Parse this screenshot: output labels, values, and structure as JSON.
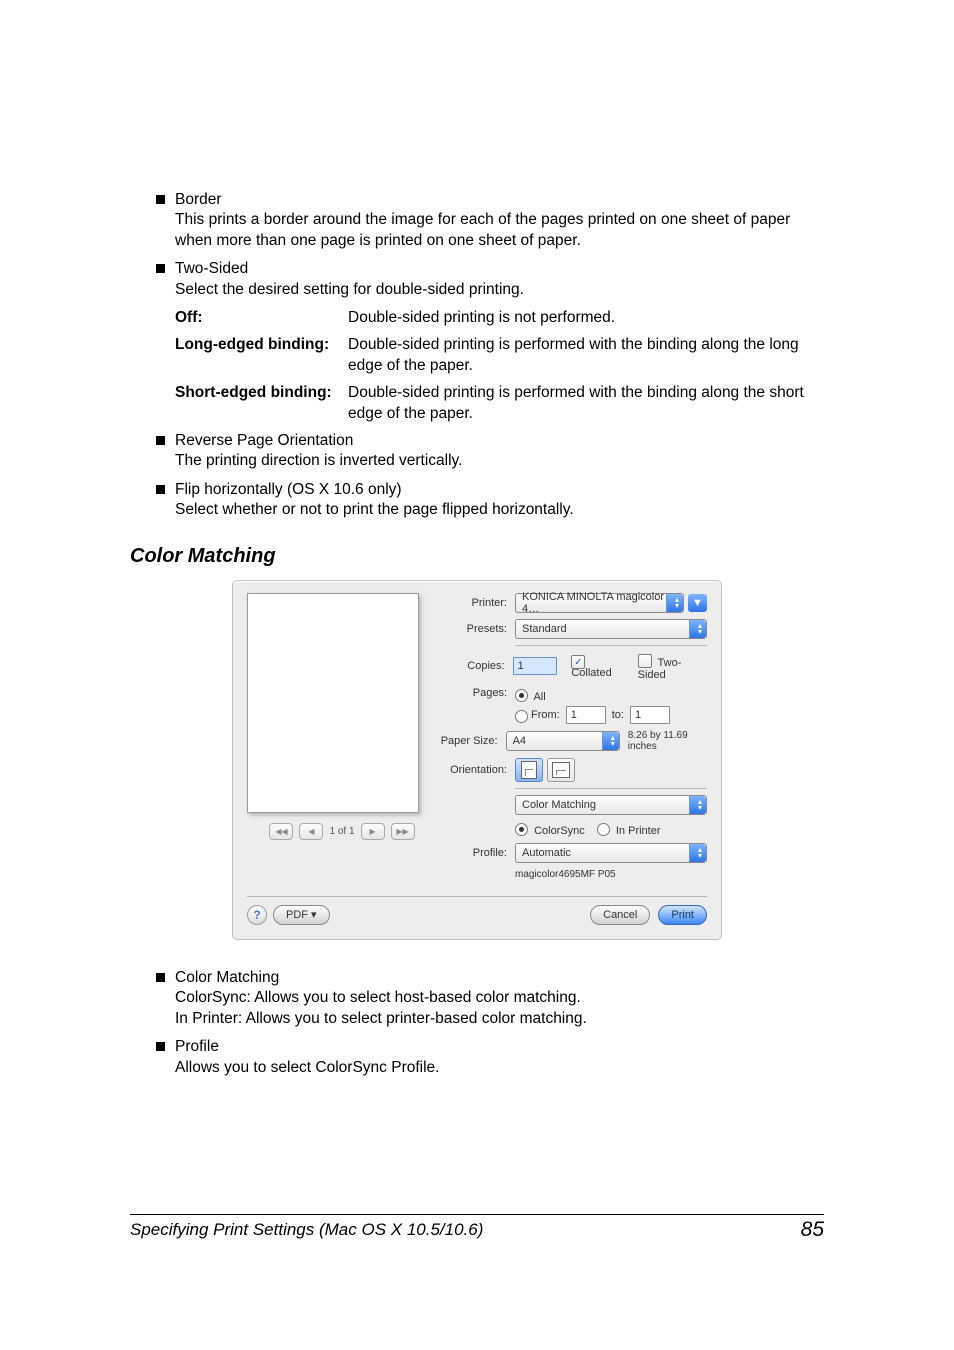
{
  "bullets": {
    "border": {
      "title": "Border",
      "body": "This prints a border around the image for each of the pages printed on one sheet of paper when more than one page is printed on one sheet of paper."
    },
    "twosided": {
      "title": "Two-Sided",
      "body": "Select the desired setting for double-sided printing."
    },
    "reverse": {
      "title": "Reverse Page Orientation",
      "body": "The printing direction is inverted vertically."
    },
    "flip": {
      "title": "Flip horizontally (OS X 10.6 only)",
      "body": "Select whether or not to print the page flipped horizontally."
    },
    "colormatching": {
      "title": "Color Matching",
      "l1": "ColorSync: Allows you to select host-based color matching.",
      "l2": "In Printer: Allows you to select printer-based color matching."
    },
    "profile": {
      "title": "Profile",
      "body": "Allows you to select ColorSync Profile."
    }
  },
  "defs": {
    "off": {
      "term": "Off:",
      "body": "Double-sided printing is not performed."
    },
    "long": {
      "term": "Long-edged binding:",
      "body": "Double-sided printing is performed with the binding along the long edge of the paper."
    },
    "short": {
      "term": "Short-edged binding:",
      "body": "Double-sided printing is performed with the binding along the short edge of the paper."
    }
  },
  "section": {
    "title": "Color Matching"
  },
  "dialog": {
    "labels": {
      "printer": "Printer:",
      "presets": "Presets:",
      "copies": "Copies:",
      "pages": "Pages:",
      "paper": "Paper Size:",
      "orientation": "Orientation:",
      "profile": "Profile:"
    },
    "values": {
      "printer": "KONICA MINOLTA magicolor 4…",
      "presets": "Standard",
      "copies": "1",
      "collated": "Collated",
      "twosided": "Two-Sided",
      "pages_all": "All",
      "pages_from": "From:",
      "pages_from_v": "1",
      "pages_to": "to:",
      "pages_to_v": "1",
      "paper": "A4",
      "paper_dim": "8.26 by 11.69 inches",
      "section_dd": "Color Matching",
      "opt_colorsync": "ColorSync",
      "opt_inprinter": "In Printer",
      "profile": "Automatic",
      "profile_sub": "magicolor4695MF P05"
    },
    "nav": {
      "page_of": "1 of 1"
    },
    "buttons": {
      "pdf": "PDF ▾",
      "cancel": "Cancel",
      "print": "Print"
    }
  },
  "footer": {
    "left": "Specifying Print Settings (Mac OS X 10.5/10.6)",
    "right": "85"
  }
}
